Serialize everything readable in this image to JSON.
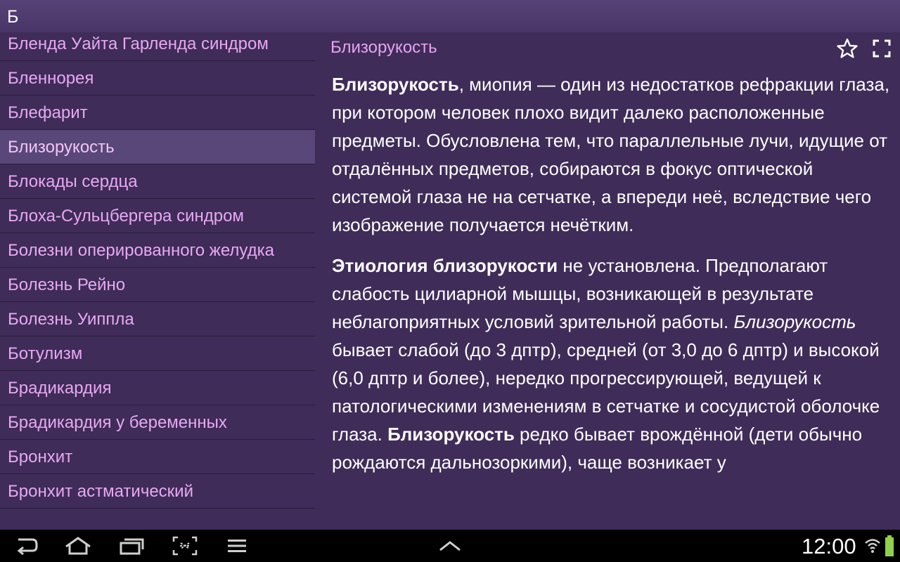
{
  "section_letter": "Б",
  "list": {
    "items": [
      {
        "label": "Бленда Уайта Гарленда синдром",
        "selected": false
      },
      {
        "label": "Бленнорея",
        "selected": false
      },
      {
        "label": "Блефарит",
        "selected": false
      },
      {
        "label": "Близорукость",
        "selected": true
      },
      {
        "label": "Блокады сердца",
        "selected": false
      },
      {
        "label": "Блоха-Сульцбергера синдром",
        "selected": false
      },
      {
        "label": "Болезни оперированного желудка",
        "selected": false
      },
      {
        "label": "Болезнь Рейно",
        "selected": false
      },
      {
        "label": "Болезнь Уиппла",
        "selected": false
      },
      {
        "label": "Ботулизм",
        "selected": false
      },
      {
        "label": "Брадикардия",
        "selected": false
      },
      {
        "label": "Брадикардия у беременных",
        "selected": false
      },
      {
        "label": "Бронхит",
        "selected": false
      },
      {
        "label": "Бронхит астматический",
        "selected": false
      }
    ]
  },
  "detail": {
    "title": "Близорукость",
    "favorite_icon": "star-outline-icon",
    "fullscreen_icon": "fullscreen-icon",
    "p1": {
      "bold": "Близорукость",
      "text": ", миопия — один из недостатков рефракции глаза, при котором человек плохо видит далеко расположенные предметы. Обусловлена тем, что параллельные лучи, идущие от отдалённых предметов, собираются в фокус оптической системой глаза не на сетчатке, а впереди неё, вследствие чего изображение получается нечётким."
    },
    "p2": {
      "bold1": "Этиология близорукости",
      "text1": " не установлена. Предполагают слабость цилиарной мышцы, возникающей в результате неблагоприятных условий зрительной работы. ",
      "italic": "Близорукость",
      "text2": " бывает слабой (до 3 дптр), средней (от 3,0 до 6 дптр) и высокой (6,0 дптр и более), нередко прогрессирующей, ведущей к патологическими изменениям в сетчатке и сосудистой оболочке глаза. ",
      "bold2": "Близорукость",
      "text3": " редко бывает врождённой (дети обычно рождаются дальнозоркими), чаще возникает у"
    }
  },
  "statusbar": {
    "time": "12:00",
    "icons": [
      "back-icon",
      "home-icon",
      "recent-apps-icon",
      "screenshot-icon",
      "menu-icon",
      "expand-up-icon",
      "wifi-icon",
      "battery-icon"
    ]
  },
  "colors": {
    "background": "#3f2c58",
    "list_text": "#e7a9f2",
    "selected_bg": "#5a4779",
    "title": "#e5a3f0",
    "body_text": "#ffffff",
    "battery": "#8fd14f"
  }
}
